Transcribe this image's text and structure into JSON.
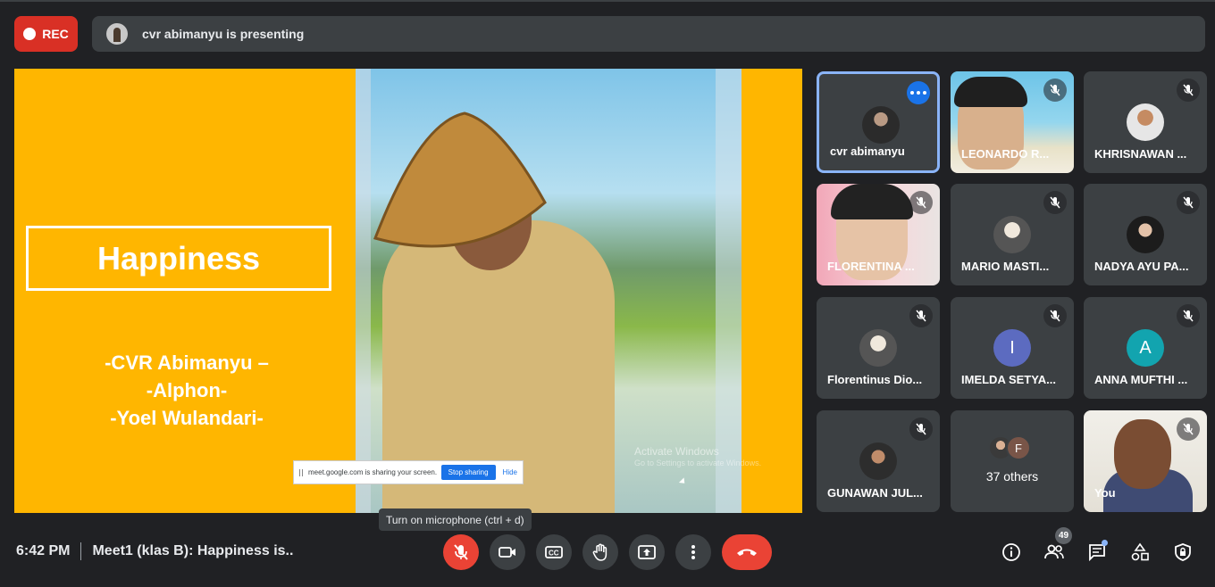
{
  "rec_label": "REC",
  "presenting": "cvr abimanyu is presenting",
  "slide": {
    "title": "Happiness",
    "authors": [
      "-CVR Abimanyu –",
      "-Alphon-",
      "-Yoel Wulandari-"
    ],
    "watermark": "Activate Windows",
    "watermark_sub": "Go to Settings to activate Windows."
  },
  "share_bar": {
    "text": "meet.google.com is sharing your screen.",
    "stop_label": "Stop sharing",
    "hide_label": "Hide"
  },
  "participants": [
    {
      "name": "cvr abimanyu"
    },
    {
      "name": "LEONARDO R..."
    },
    {
      "name": "KHRISNAWAN ..."
    },
    {
      "name": "FLORENTINA ..."
    },
    {
      "name": "MARIO MASTI..."
    },
    {
      "name": "NADYA AYU PA..."
    },
    {
      "name": "Florentinus Dio..."
    },
    {
      "name": "IMELDA SETYA...",
      "initial": "I",
      "color": "#5c6bc0"
    },
    {
      "name": "ANNA MUFTHI ...",
      "initial": "A",
      "color": "#12a4af"
    },
    {
      "name": "GUNAWAN JUL..."
    },
    {
      "name": "37 others",
      "initial": "F"
    },
    {
      "name": "You"
    }
  ],
  "tooltip": "Turn on microphone (ctrl + d)",
  "bottom": {
    "time": "6:42 PM",
    "meeting_title": "Meet1 (klas B): Happiness is..",
    "people_count": "49"
  },
  "colors": {
    "end_call": "#ea4335",
    "slide_bg": "#ffb600",
    "active_border": "#8ab4f8"
  }
}
